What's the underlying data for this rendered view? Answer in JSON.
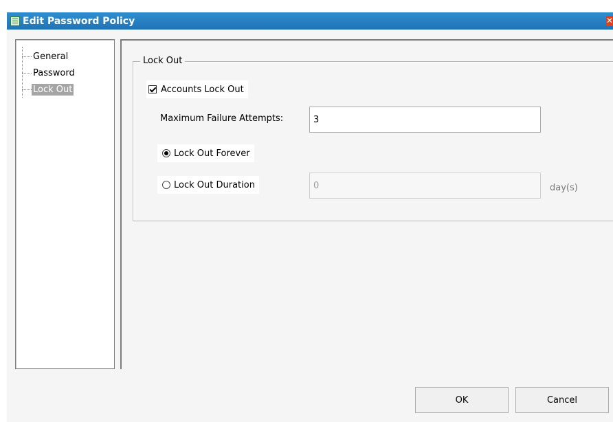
{
  "window": {
    "title": "Edit Password Policy",
    "icon": "policy-book-icon",
    "close_icon": "close-icon",
    "accent_color": "#1f73b6"
  },
  "tree": {
    "items": [
      {
        "label": "General",
        "selected": false
      },
      {
        "label": "Password",
        "selected": false
      },
      {
        "label": "Lock Out",
        "selected": true
      }
    ]
  },
  "lockout": {
    "group_title": "Lock Out",
    "accounts_lockout_label": "Accounts Lock Out",
    "accounts_lockout_checked": true,
    "max_attempts_label": "Maximum Failure Attempts:",
    "max_attempts_value": "3",
    "forever_label": "Lock Out Forever",
    "forever_selected": true,
    "duration_label": "Lock Out Duration",
    "duration_selected": false,
    "duration_value": "0",
    "duration_unit": "day(s)"
  },
  "buttons": {
    "ok": "OK",
    "cancel": "Cancel"
  }
}
